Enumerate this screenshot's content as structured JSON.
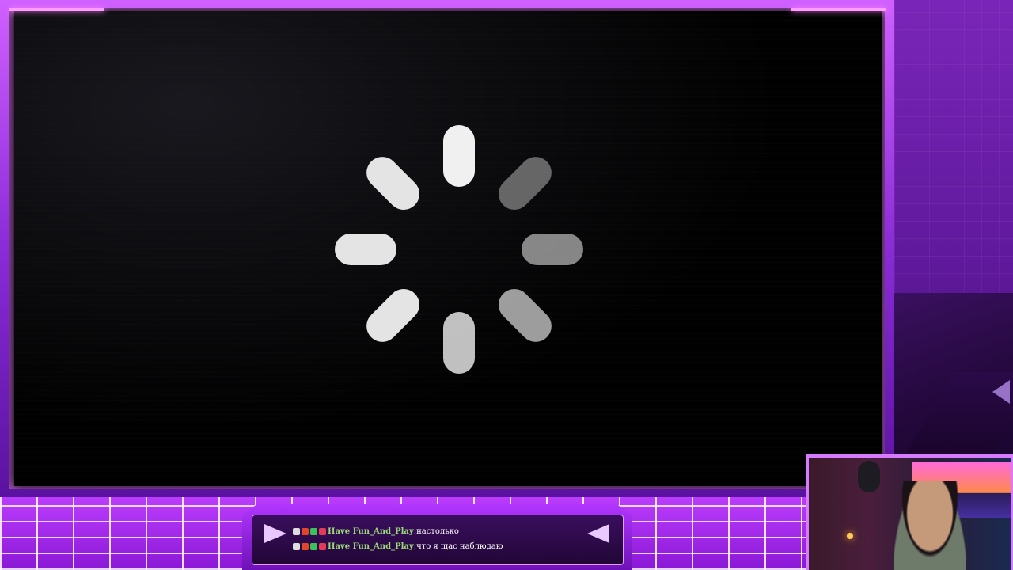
{
  "scene": {
    "accent_color": "#c040ff",
    "frame_glow_color": "#ff9cff"
  },
  "player": {
    "status": "loading",
    "spinner_icon": "loading-spinner-icon",
    "spinner_opacities": [
      1.0,
      0.4,
      0.55,
      0.65,
      0.8,
      0.95,
      0.95,
      0.95
    ]
  },
  "chat": {
    "messages": [
      {
        "username": "Have Fun_And_Play",
        "separator": ":",
        "text": " настолько"
      },
      {
        "username": "Have Fun_And_Play",
        "separator": ":",
        "text": " что я щас наблюдаю"
      }
    ],
    "left_arrow_icon": "chevron-right-icon",
    "right_arrow_icon": "chevron-left-icon",
    "badge_colors": [
      "#dddddd",
      "#e0462b",
      "#39c15a",
      "#e43a5a"
    ]
  },
  "webcam": {
    "label": ""
  }
}
